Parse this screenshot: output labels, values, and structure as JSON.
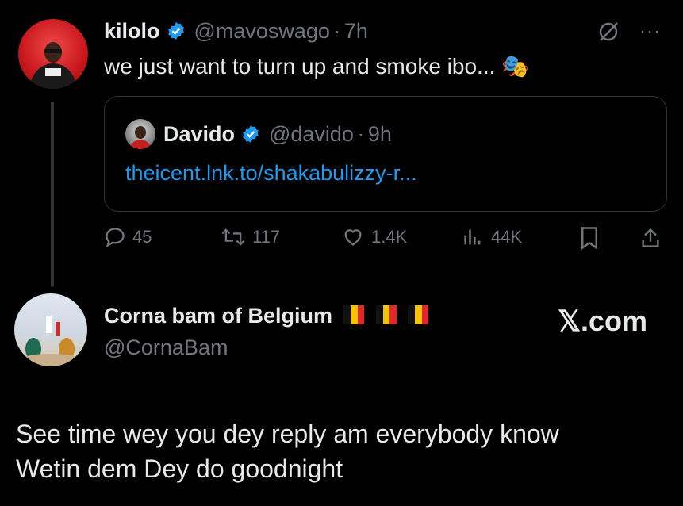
{
  "tweet": {
    "author_name": "kilolo",
    "author_handle": "@mavoswago",
    "separator": "·",
    "time": "7h",
    "text": "we just want to turn up and smoke ibo...",
    "emoji": "🎭"
  },
  "quoted": {
    "author_name": "Davido",
    "author_handle": "@davido",
    "separator": "·",
    "time": "9h",
    "link": "theicent.lnk.to/shakabulizzy-r..."
  },
  "actions": {
    "replies": "45",
    "reposts": "117",
    "likes": "1.4K",
    "views": "44K"
  },
  "reply_header": {
    "author_name": "Corna bam of Belgium",
    "author_handle": "@CornaBam",
    "watermark": "𝕏.com"
  },
  "reply_text": {
    "line1": "See time wey you dey reply am everybody know",
    "line2": "Wetin dem Dey do goodnight"
  },
  "colors": {
    "background": "#000000",
    "text": "#e7e9ea",
    "muted": "#71767b",
    "link": "#1d9bf0",
    "verified": "#1d9bf0"
  }
}
